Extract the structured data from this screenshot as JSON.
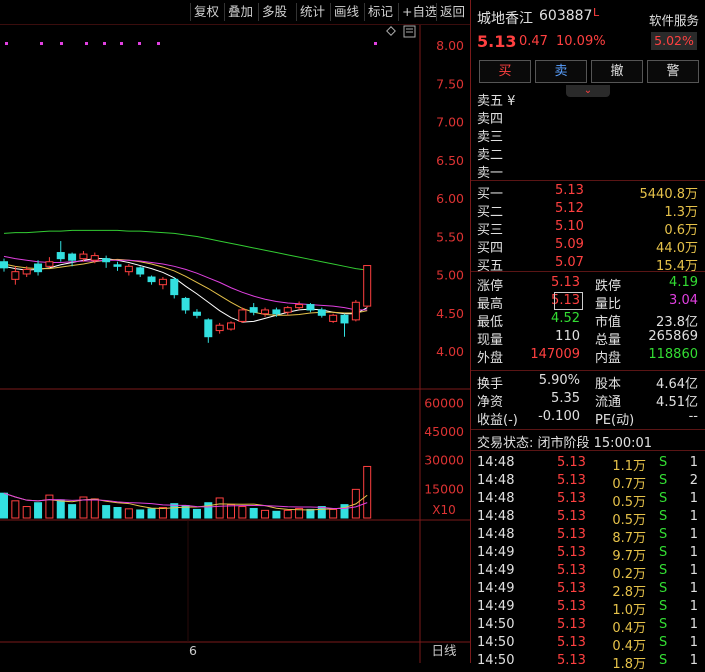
{
  "toolbar": {
    "buttons": [
      "复权",
      "叠加",
      "多股",
      "统计",
      "画线",
      "标记",
      "+自选",
      "返回"
    ]
  },
  "price_axis": [
    "8.00",
    "7.50",
    "7.00",
    "6.50",
    "6.00",
    "5.50",
    "5.00",
    "4.50",
    "4.00"
  ],
  "volume_axis": [
    "60000",
    "45000",
    "30000",
    "15000"
  ],
  "volume_unit": "X10",
  "x_tick": "6",
  "period_label": "日线",
  "chart_data": {
    "type": "candlestick",
    "ylim": [
      3.5,
      8.25
    ],
    "candles": [
      {
        "o": 5.18,
        "c": 5.1,
        "h": 5.22,
        "l": 5.05
      },
      {
        "o": 4.95,
        "c": 5.05,
        "h": 5.12,
        "l": 4.88
      },
      {
        "o": 5.02,
        "c": 5.08,
        "h": 5.12,
        "l": 4.98
      },
      {
        "o": 5.15,
        "c": 5.05,
        "h": 5.2,
        "l": 5.0
      },
      {
        "o": 5.12,
        "c": 5.18,
        "h": 5.24,
        "l": 5.1
      },
      {
        "o": 5.3,
        "c": 5.22,
        "h": 5.45,
        "l": 5.18
      },
      {
        "o": 5.28,
        "c": 5.2,
        "h": 5.3,
        "l": 5.12
      },
      {
        "o": 5.22,
        "c": 5.28,
        "h": 5.32,
        "l": 5.18
      },
      {
        "o": 5.2,
        "c": 5.26,
        "h": 5.3,
        "l": 5.16
      },
      {
        "o": 5.22,
        "c": 5.18,
        "h": 5.26,
        "l": 5.1
      },
      {
        "o": 5.14,
        "c": 5.12,
        "h": 5.18,
        "l": 5.06
      },
      {
        "o": 5.05,
        "c": 5.12,
        "h": 5.15,
        "l": 5.0
      },
      {
        "o": 5.1,
        "c": 5.02,
        "h": 5.12,
        "l": 4.98
      },
      {
        "o": 4.98,
        "c": 4.92,
        "h": 5.0,
        "l": 4.88
      },
      {
        "o": 4.88,
        "c": 4.95,
        "h": 4.98,
        "l": 4.82
      },
      {
        "o": 4.95,
        "c": 4.75,
        "h": 4.98,
        "l": 4.7
      },
      {
        "o": 4.7,
        "c": 4.55,
        "h": 4.72,
        "l": 4.5
      },
      {
        "o": 4.52,
        "c": 4.48,
        "h": 4.56,
        "l": 4.44
      },
      {
        "o": 4.42,
        "c": 4.2,
        "h": 4.44,
        "l": 4.12
      },
      {
        "o": 4.28,
        "c": 4.35,
        "h": 4.38,
        "l": 4.24
      },
      {
        "o": 4.3,
        "c": 4.38,
        "h": 4.4,
        "l": 4.28
      },
      {
        "o": 4.4,
        "c": 4.55,
        "h": 4.58,
        "l": 4.38
      },
      {
        "o": 4.58,
        "c": 4.52,
        "h": 4.64,
        "l": 4.48
      },
      {
        "o": 4.5,
        "c": 4.55,
        "h": 4.58,
        "l": 4.46
      },
      {
        "o": 4.55,
        "c": 4.5,
        "h": 4.58,
        "l": 4.46
      },
      {
        "o": 4.52,
        "c": 4.58,
        "h": 4.6,
        "l": 4.48
      },
      {
        "o": 4.58,
        "c": 4.62,
        "h": 4.66,
        "l": 4.55
      },
      {
        "o": 4.62,
        "c": 4.55,
        "h": 4.64,
        "l": 4.52
      },
      {
        "o": 4.55,
        "c": 4.48,
        "h": 4.58,
        "l": 4.45
      },
      {
        "o": 4.4,
        "c": 4.48,
        "h": 4.5,
        "l": 4.38
      },
      {
        "o": 4.48,
        "c": 4.38,
        "h": 4.5,
        "l": 4.2
      },
      {
        "o": 4.42,
        "c": 4.65,
        "h": 4.68,
        "l": 4.4
      },
      {
        "o": 4.6,
        "c": 5.13,
        "h": 5.13,
        "l": 4.58
      }
    ],
    "ma_series": [
      {
        "color": "#ffffff",
        "values": [
          5.12,
          5.09,
          5.07,
          5.08,
          5.1,
          5.14,
          5.17,
          5.2,
          5.22,
          5.22,
          5.2,
          5.17,
          5.13,
          5.09,
          5.04,
          4.97,
          4.86,
          4.76,
          4.65,
          4.54,
          4.45,
          4.39,
          4.4,
          4.44,
          4.48,
          4.52,
          4.55,
          4.56,
          4.55,
          4.52,
          4.5,
          4.5,
          4.58
        ]
      },
      {
        "color": "#e6c24a",
        "values": [
          5.15,
          5.12,
          5.1,
          5.09,
          5.09,
          5.11,
          5.13,
          5.15,
          5.18,
          5.2,
          5.21,
          5.2,
          5.18,
          5.15,
          5.11,
          5.06,
          4.99,
          4.91,
          4.83,
          4.74,
          4.65,
          4.57,
          4.52,
          4.49,
          4.48,
          4.48,
          4.49,
          4.51,
          4.52,
          4.52,
          4.51,
          4.51,
          4.54
        ]
      },
      {
        "color": "#e040e0",
        "values": [
          5.25,
          5.22,
          5.2,
          5.18,
          5.17,
          5.17,
          5.18,
          5.19,
          5.19,
          5.2,
          5.2,
          5.2,
          5.19,
          5.17,
          5.15,
          5.12,
          5.08,
          5.03,
          4.97,
          4.91,
          4.84,
          4.78,
          4.73,
          4.69,
          4.66,
          4.64,
          4.63,
          4.62,
          4.61,
          4.6,
          4.58,
          4.55,
          4.55
        ]
      },
      {
        "color": "#33cc33",
        "values": [
          5.55,
          5.56,
          5.56,
          5.57,
          5.58,
          5.58,
          5.59,
          5.59,
          5.59,
          5.59,
          5.59,
          5.58,
          5.58,
          5.57,
          5.56,
          5.55,
          5.53,
          5.51,
          5.48,
          5.45,
          5.42,
          5.39,
          5.36,
          5.33,
          5.3,
          5.27,
          5.24,
          5.21,
          5.18,
          5.15,
          5.12,
          5.09,
          5.07
        ]
      }
    ],
    "volumes": [
      13000,
      9000,
      6000,
      8000,
      12000,
      9500,
      7000,
      11000,
      10000,
      6500,
      5500,
      4800,
      4200,
      4800,
      5500,
      7500,
      6500,
      4500,
      8000,
      10500,
      7000,
      6000,
      5000,
      4000,
      3500,
      4000,
      5000,
      4500,
      6000,
      4500,
      7000,
      15000,
      27000
    ],
    "vol_ylim": [
      0,
      66000
    ]
  },
  "stock": {
    "name": "城地香江",
    "code": "603887",
    "flag": "L",
    "price": "5.13",
    "change": "0.47",
    "change_pct": "10.09%",
    "service_label": "软件服务",
    "service_pct": "5.02%"
  },
  "trade_buttons": [
    "买",
    "卖",
    "撤",
    "警"
  ],
  "asks": [
    "卖五 ¥",
    "卖四",
    "卖三",
    "卖二",
    "卖一"
  ],
  "bids": [
    {
      "label": "买一",
      "price": "5.13",
      "vol": "5440.8万"
    },
    {
      "label": "买二",
      "price": "5.12",
      "vol": "1.3万"
    },
    {
      "label": "买三",
      "price": "5.10",
      "vol": "0.6万"
    },
    {
      "label": "买四",
      "price": "5.09",
      "vol": "44.0万"
    },
    {
      "label": "买五",
      "price": "5.07",
      "vol": "15.4万"
    }
  ],
  "stats": [
    {
      "l1": "涨停",
      "v1": "5.13",
      "c1": "red",
      "l2": "跌停",
      "v2": "4.19",
      "c2": "green"
    },
    {
      "l1": "最高",
      "v1": "5.13",
      "c1": "red",
      "l2": "量比",
      "v2": "3.04",
      "c2": "magenta"
    },
    {
      "l1": "最低",
      "v1": "4.52",
      "c1": "green",
      "l2": "市值",
      "v2": "23.8亿",
      "c2": "white"
    },
    {
      "l1": "现量",
      "v1": "110",
      "c1": "white",
      "l2": "总量",
      "v2": "265869",
      "c2": "white"
    },
    {
      "l1": "外盘",
      "v1": "147009",
      "c1": "red",
      "l2": "内盘",
      "v2": "118860",
      "c2": "green"
    }
  ],
  "stats2": [
    {
      "l1": "换手",
      "v1": "5.90%",
      "l2": "股本",
      "v2": "4.64亿"
    },
    {
      "l1": "净资",
      "v1": "5.35",
      "l2": "流通",
      "v2": "4.51亿"
    },
    {
      "l1": "收益(-)",
      "v1": "-0.100",
      "l2": "PE(动)",
      "v2": "--"
    }
  ],
  "status_line": "交易状态: 闭市阶段 15:00:01",
  "ticks": [
    {
      "t": "14:48",
      "p": "5.13",
      "v": "1.1万",
      "s": "S",
      "n": "1"
    },
    {
      "t": "14:48",
      "p": "5.13",
      "v": "0.7万",
      "s": "S",
      "n": "2"
    },
    {
      "t": "14:48",
      "p": "5.13",
      "v": "0.5万",
      "s": "S",
      "n": "1"
    },
    {
      "t": "14:48",
      "p": "5.13",
      "v": "0.5万",
      "s": "S",
      "n": "1"
    },
    {
      "t": "14:48",
      "p": "5.13",
      "v": "8.7万",
      "s": "S",
      "n": "1"
    },
    {
      "t": "14:49",
      "p": "5.13",
      "v": "9.7万",
      "s": "S",
      "n": "1"
    },
    {
      "t": "14:49",
      "p": "5.13",
      "v": "0.2万",
      "s": "S",
      "n": "1"
    },
    {
      "t": "14:49",
      "p": "5.13",
      "v": "2.8万",
      "s": "S",
      "n": "1"
    },
    {
      "t": "14:49",
      "p": "5.13",
      "v": "1.0万",
      "s": "S",
      "n": "1"
    },
    {
      "t": "14:50",
      "p": "5.13",
      "v": "0.4万",
      "s": "S",
      "n": "1"
    },
    {
      "t": "14:50",
      "p": "5.13",
      "v": "0.4万",
      "s": "S",
      "n": "1"
    },
    {
      "t": "14:50",
      "p": "5.13",
      "v": "1.8万",
      "s": "S",
      "n": "1"
    }
  ]
}
